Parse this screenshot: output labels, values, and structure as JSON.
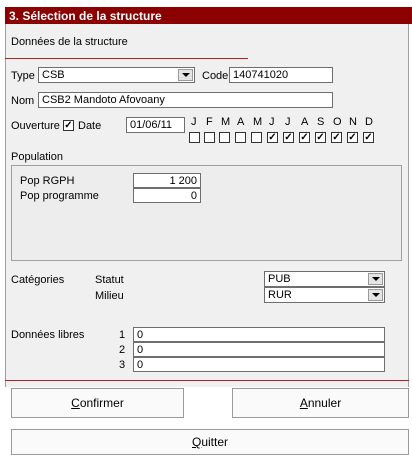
{
  "window": {
    "title": "3. Sélection de la structure"
  },
  "section": {
    "heading": "Données de la structure"
  },
  "structure": {
    "type_label": "Type",
    "type_value": "CSB",
    "code_label": "Code",
    "code_value": "140741020",
    "nom_label": "Nom",
    "nom_value": "CSB2 Mandoto Afovoany",
    "ouverture_label": "Ouverture",
    "ouverture_checked": "✓",
    "date_label": "Date",
    "date_value": "01/06/11"
  },
  "months": [
    {
      "letter": "J",
      "checked": ""
    },
    {
      "letter": "F",
      "checked": ""
    },
    {
      "letter": "M",
      "checked": ""
    },
    {
      "letter": "A",
      "checked": ""
    },
    {
      "letter": "M",
      "checked": ""
    },
    {
      "letter": "J",
      "checked": "✓"
    },
    {
      "letter": "J",
      "checked": "✓"
    },
    {
      "letter": "A",
      "checked": "✓"
    },
    {
      "letter": "S",
      "checked": "✓"
    },
    {
      "letter": "O",
      "checked": "✓"
    },
    {
      "letter": "N",
      "checked": "✓"
    },
    {
      "letter": "D",
      "checked": "✓"
    }
  ],
  "population": {
    "label": "Population",
    "rgph_label": "Pop RGPH",
    "rgph_value": "1 200",
    "programme_label": "Pop programme",
    "programme_value": "0"
  },
  "categories": {
    "label": "Catégories",
    "statut_label": "Statut",
    "statut_value": "PUB",
    "milieu_label": "Milieu",
    "milieu_value": "RUR"
  },
  "libres": {
    "label": "Données libres",
    "rows": [
      {
        "num": "1",
        "value": "0"
      },
      {
        "num": "2",
        "value": "0"
      },
      {
        "num": "3",
        "value": "0"
      }
    ]
  },
  "buttons": {
    "confirmer_first": "C",
    "confirmer_rest": "onfirmer",
    "annuler_first": "A",
    "annuler_rest": "nnuler",
    "quitter_first": "Q",
    "quitter_rest": "uitter"
  }
}
